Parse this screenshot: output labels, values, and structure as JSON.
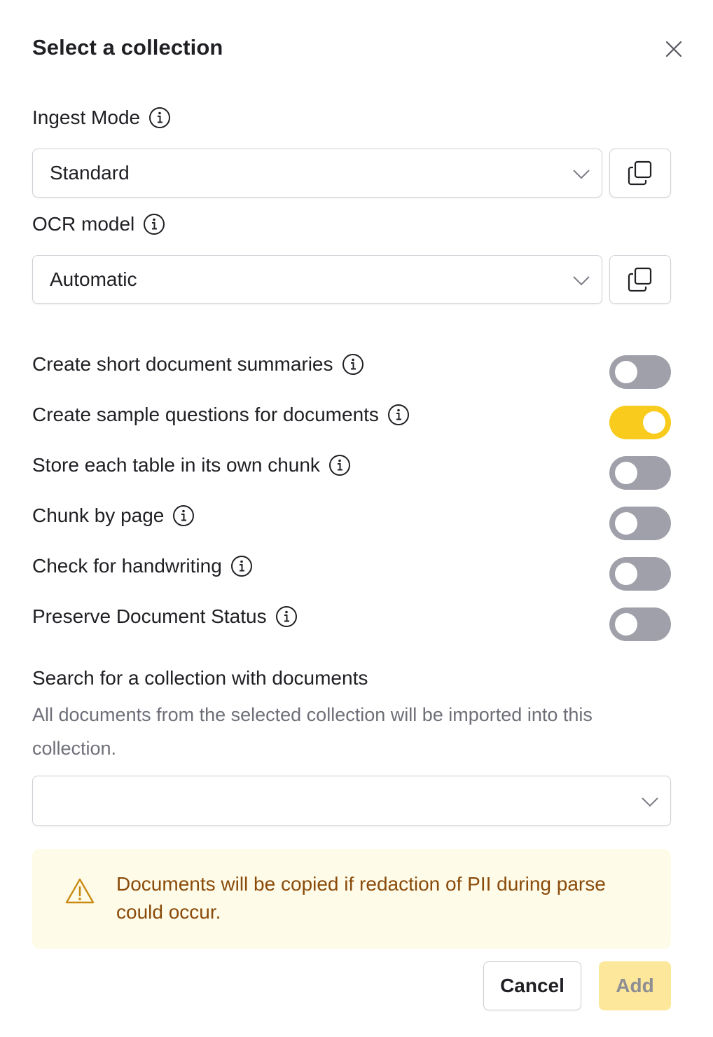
{
  "dialog": {
    "title": "Select a collection"
  },
  "ingest_mode": {
    "label": "Ingest Mode",
    "value": "Standard"
  },
  "ocr_model": {
    "label": "OCR model",
    "value": "Automatic"
  },
  "toggles": [
    {
      "label": "Create short document summaries",
      "on": false
    },
    {
      "label": "Create sample questions for documents",
      "on": true
    },
    {
      "label": "Store each table in its own chunk",
      "on": false
    },
    {
      "label": "Chunk by page",
      "on": false
    },
    {
      "label": "Check for handwriting",
      "on": false
    },
    {
      "label": "Preserve Document Status",
      "on": false
    }
  ],
  "collection_search": {
    "title": "Search for a collection with documents",
    "description": "All documents from the selected collection will be imported into this collection.",
    "value": ""
  },
  "alert": {
    "message": "Documents will be copied if redaction of PII during parse could occur."
  },
  "footer": {
    "cancel_label": "Cancel",
    "add_label": "Add"
  },
  "colors": {
    "toggle_on": "#f8cb1c",
    "toggle_off": "#9fa0a9",
    "alert_bg": "#fefbe8",
    "alert_text": "#8a4b0a",
    "add_button_disabled": "#fce79b"
  }
}
